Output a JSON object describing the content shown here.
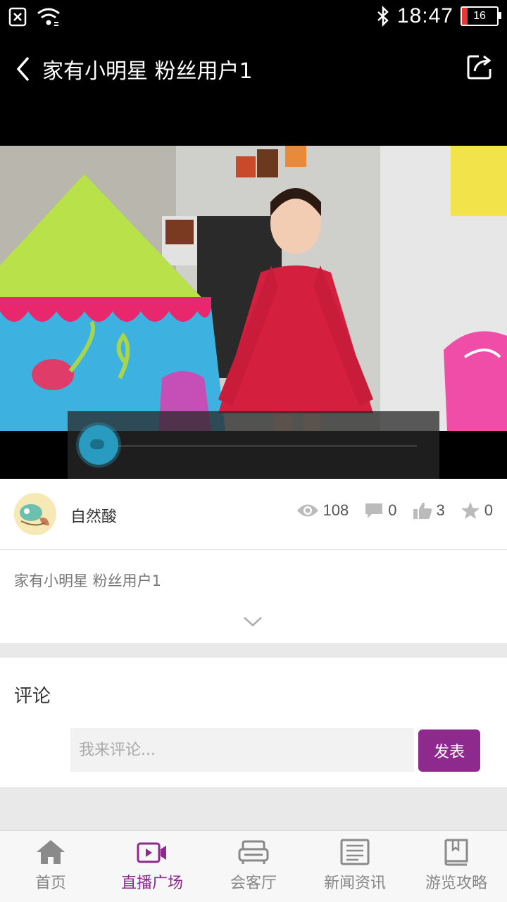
{
  "status_bar": {
    "time": "18:47",
    "battery": "16",
    "icons": [
      "no-sim-icon",
      "wifi-icon",
      "bluetooth-icon",
      "battery-icon"
    ]
  },
  "header": {
    "title": "家有小明星 粉丝用户1",
    "back_icon": "chevron-left-icon",
    "share_icon": "share-icon"
  },
  "video": {
    "progress": 0.0
  },
  "author": {
    "name": "自然酸",
    "avatar_icon": "avatar-icon"
  },
  "stats": {
    "views": "108",
    "comments": "0",
    "likes": "3",
    "favorites": "0"
  },
  "description": {
    "text": "家有小明星 粉丝用户1",
    "expand_icon": "chevron-down-icon"
  },
  "comments": {
    "title": "评论",
    "input_placeholder": "我来评论...",
    "submit_label": "发表"
  },
  "tabs": [
    {
      "label": "首页",
      "icon": "home-icon",
      "active": false
    },
    {
      "label": "直播广场",
      "icon": "live-video-icon",
      "active": true
    },
    {
      "label": "会客厅",
      "icon": "sofa-icon",
      "active": false
    },
    {
      "label": "新闻资讯",
      "icon": "news-icon",
      "active": false
    },
    {
      "label": "游览攻略",
      "icon": "book-icon",
      "active": false
    }
  ],
  "colors": {
    "accent": "#8e2a8e",
    "progress": "#2a9bc0"
  }
}
